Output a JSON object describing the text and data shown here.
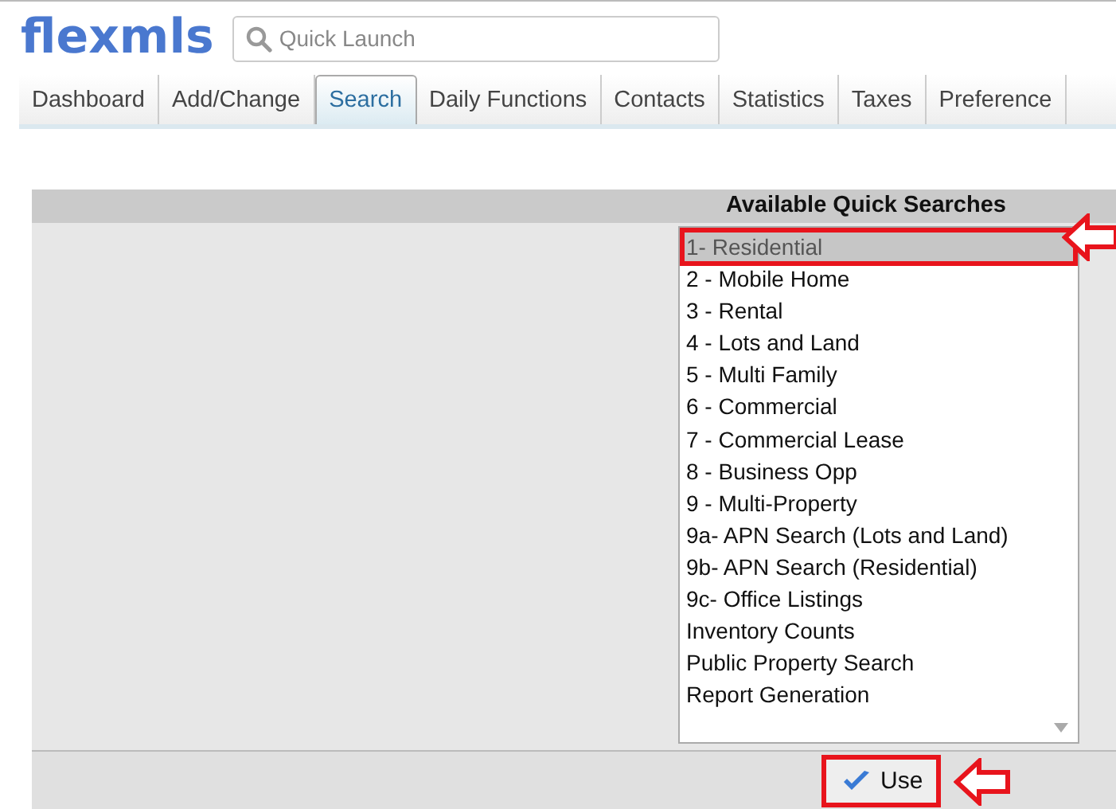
{
  "logo": "flexmls",
  "quick_launch": {
    "placeholder": "Quick Launch"
  },
  "tabs": [
    {
      "label": "Dashboard",
      "selected": false
    },
    {
      "label": "Add/Change",
      "selected": false
    },
    {
      "label": "Search",
      "selected": true
    },
    {
      "label": "Daily Functions",
      "selected": false
    },
    {
      "label": "Contacts",
      "selected": false
    },
    {
      "label": "Statistics",
      "selected": false
    },
    {
      "label": "Taxes",
      "selected": false
    },
    {
      "label": "Preference",
      "selected": false
    }
  ],
  "quick_searches": {
    "title": "Available Quick Searches",
    "items": [
      {
        "label": "1- Residential",
        "selected": true
      },
      {
        "label": "2 - Mobile Home",
        "selected": false
      },
      {
        "label": "3 - Rental",
        "selected": false
      },
      {
        "label": "4 - Lots and Land",
        "selected": false
      },
      {
        "label": "5 - Multi Family",
        "selected": false
      },
      {
        "label": "6 - Commercial",
        "selected": false
      },
      {
        "label": "7 - Commercial Lease",
        "selected": false
      },
      {
        "label": "8 - Business Opp",
        "selected": false
      },
      {
        "label": "9 - Multi-Property",
        "selected": false
      },
      {
        "label": "9a- APN Search (Lots and Land)",
        "selected": false
      },
      {
        "label": "9b- APN Search (Residential)",
        "selected": false
      },
      {
        "label": "9c- Office Listings",
        "selected": false
      },
      {
        "label": "Inventory Counts",
        "selected": false
      },
      {
        "label": "Public Property Search",
        "selected": false
      },
      {
        "label": "Report Generation",
        "selected": false
      }
    ],
    "button": "Use"
  }
}
